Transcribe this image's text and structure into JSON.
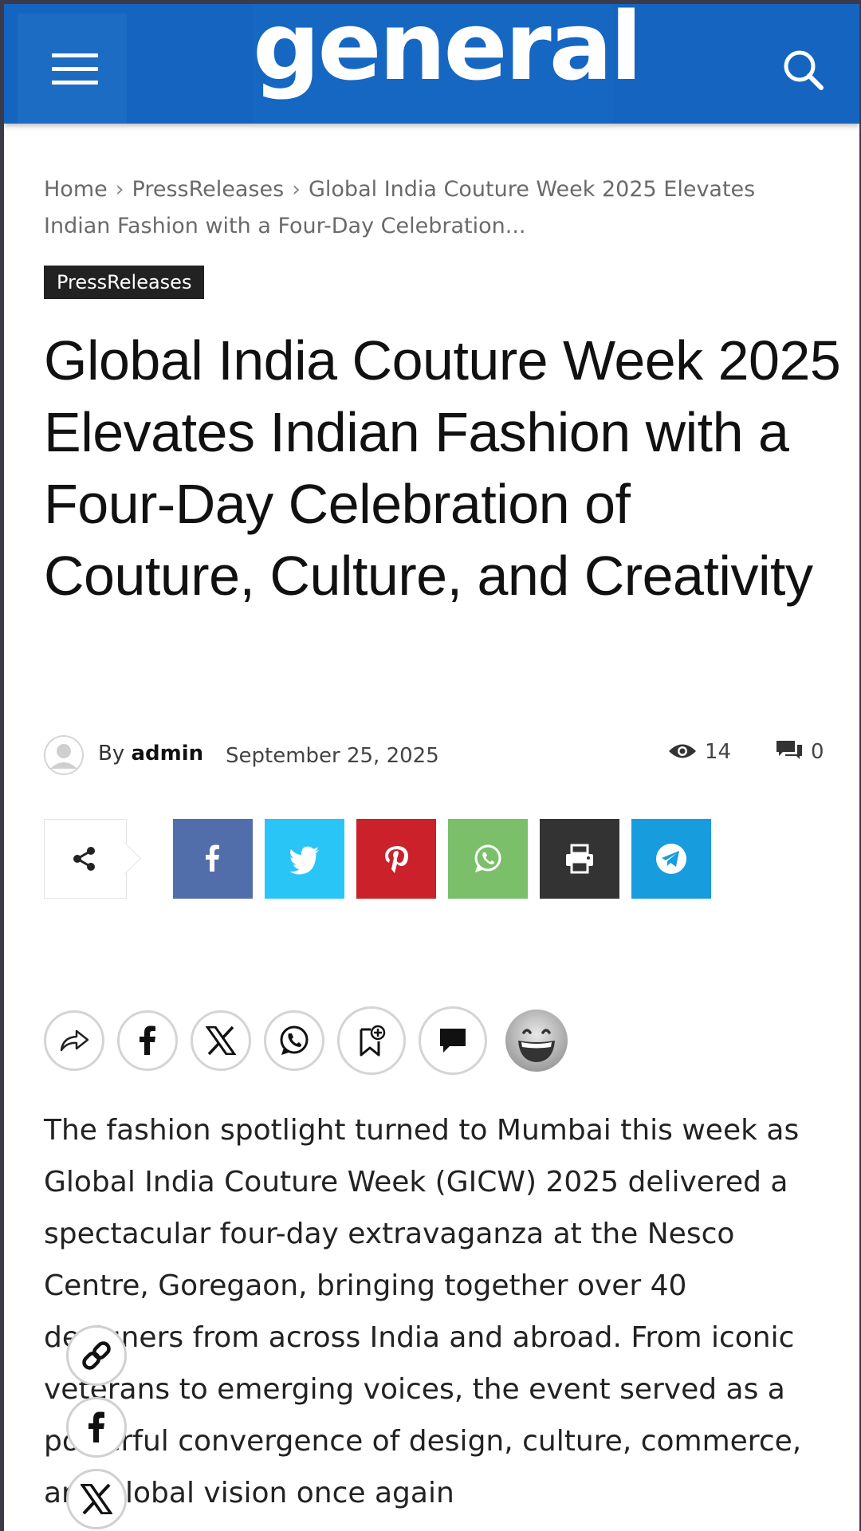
{
  "header": {
    "logo_text": "general",
    "brand_color": "#1565c0",
    "menu_icon": "hamburger-menu-icon",
    "search_icon": "search-icon"
  },
  "breadcrumb": {
    "home": "Home",
    "section": "PressReleases",
    "current": "Global India Couture Week 2025 Elevates Indian Fashion with a Four-Day Celebration..."
  },
  "category": "PressReleases",
  "article": {
    "title": "Global India Couture Week 2025 Elevates Indian Fashion with a Four-Day Celebration of Couture, Culture, and Creativity",
    "by": "By",
    "author": "admin",
    "date": "September 25, 2025",
    "views": "14",
    "comments": "0",
    "body": "The fashion spotlight turned to Mumbai this week as Global India Couture Week (GICW) 2025 delivered a spectacular four-day extravaganza at the Nesco Centre, Goregaon, bringing together over 40 designers from across India and abroad. From iconic veterans to emerging voices, the event served as a powerful convergence of design, culture, commerce, and global vision once again"
  },
  "share_buttons": [
    {
      "name": "facebook",
      "color": "#516eab"
    },
    {
      "name": "twitter",
      "color": "#29c5f6"
    },
    {
      "name": "pinterest",
      "color": "#ca212a"
    },
    {
      "name": "whatsapp",
      "color": "#7bbf6a"
    },
    {
      "name": "print",
      "color": "#333333"
    },
    {
      "name": "telegram",
      "color": "#179cde"
    }
  ],
  "circle_share": [
    "share-icon",
    "facebook-icon",
    "x-icon",
    "whatsapp-icon",
    "bookmark-icon",
    "comment-icon",
    "emoji-reaction-icon"
  ],
  "floating_share": [
    "link-icon",
    "facebook-icon",
    "x-icon"
  ]
}
